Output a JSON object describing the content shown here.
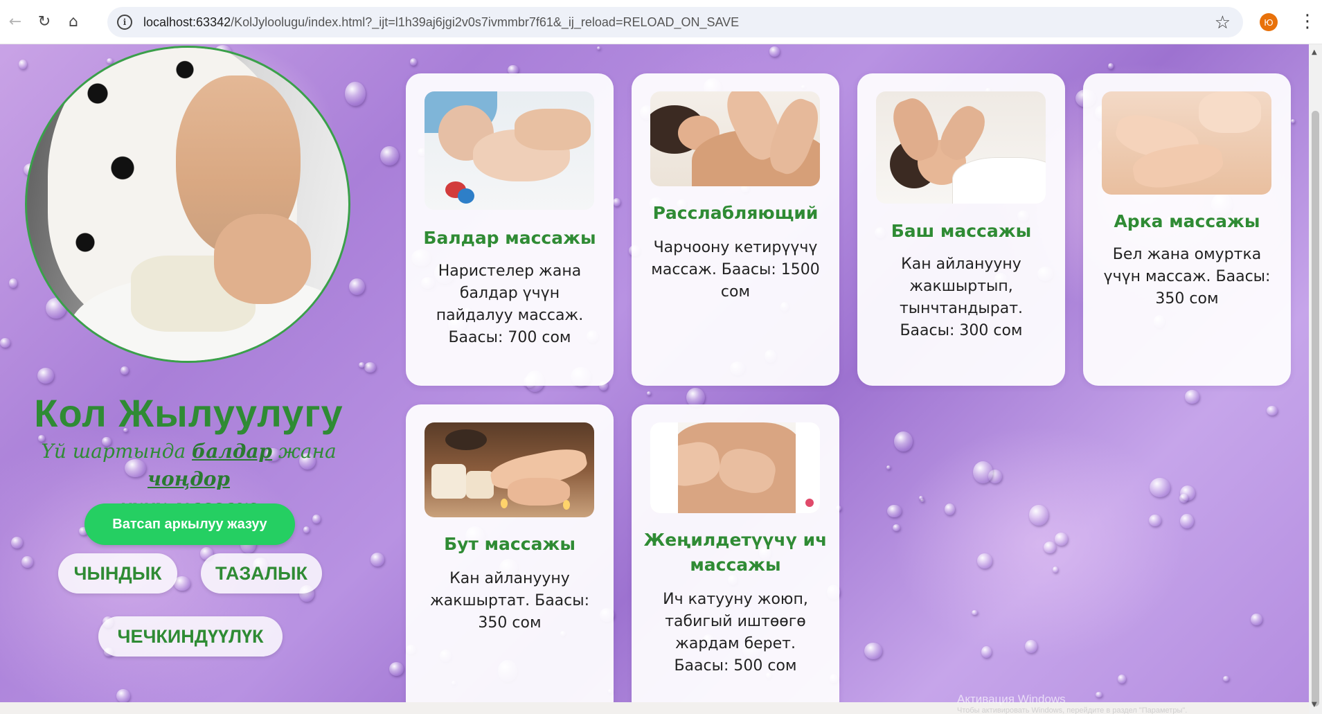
{
  "browser": {
    "url_host": "localhost:63342",
    "url_path": "/KolJyloolugu/index.html?_ijt=l1h39aj6jgi2v0s7ivmmbr7f61&_ij_reload=RELOAD_ON_SAVE",
    "profile_initial": "Ю",
    "back_icon": "back-arrow-icon",
    "reload_icon": "reload-icon",
    "home_icon": "home-icon",
    "star_icon": "star-icon",
    "menu_icon": "kebab-menu-icon"
  },
  "profile": {
    "title": "Кол Жылуулугу",
    "subtitle_part1": "Үй шартында ",
    "subtitle_link1": "балдар",
    "subtitle_part2": " жана ",
    "subtitle_link2": "чоңдор",
    "subtitle_part3": " үчүн массаж",
    "whatsapp_button": "Ватсап аркылуу жазуу",
    "values": [
      "ЧЫНДЫК",
      "ТАЗАЛЫК",
      "ЧЕЧКИНДҮҮЛҮК"
    ]
  },
  "services": [
    {
      "title": "Балдар массажы",
      "desc": "Наристелер жана балдар үчүн пайдалуу массаж. Баасы: 700 сом"
    },
    {
      "title": "Расслабляющий",
      "desc": "Чарчоону кетирүүчү массаж. Баасы: 1500 сом"
    },
    {
      "title": "Баш массажы",
      "desc": "Кан айланууну жакшыртып, тынчтандырат. Баасы: 300 сом"
    },
    {
      "title": "Арка массажы",
      "desc": "Бел жана омуртка үчүн массаж. Баасы: 350 сом"
    },
    {
      "title": "Бут массажы",
      "desc": "Кан айланууну жакшыртат. Баасы: 350 сом"
    },
    {
      "title": "Жеңилдетүүчү ич массажы",
      "desc": "Ич катууну жоюп, табигый иштөөгө жардам берет. Баасы: 500 сом"
    }
  ],
  "os_watermark": {
    "line1": "Активация Windows",
    "line2": "Чтобы активировать Windows, перейдите в раздел \"Параметры\"."
  },
  "colors": {
    "accent_green": "#2f8b34",
    "whatsapp_green": "#25cf62",
    "background_purple": "#b08ce0"
  }
}
